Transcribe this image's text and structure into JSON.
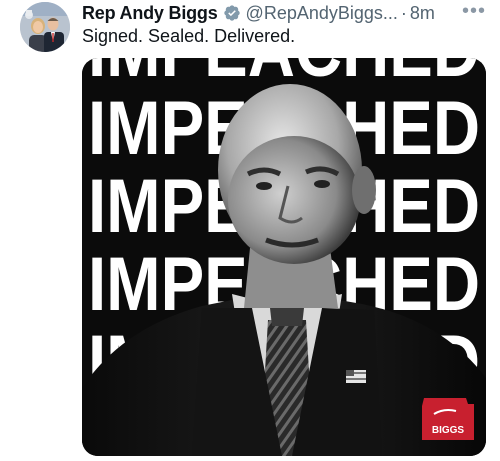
{
  "post": {
    "author_name": "Rep Andy Biggs",
    "handle": "@RepAndyBiggs...",
    "separator": "·",
    "timestamp": "8m",
    "more_label": "•••",
    "text": "Signed. Sealed. Delivered."
  },
  "media": {
    "repeated_word": "IMPEACHED",
    "logo_label": "BIGGS"
  },
  "colors": {
    "verified": "#829aab",
    "logo_red": "#c8202f",
    "muted_text": "#536471"
  },
  "icons": {
    "verified": "verified-badge-icon",
    "more": "more-options-icon"
  }
}
